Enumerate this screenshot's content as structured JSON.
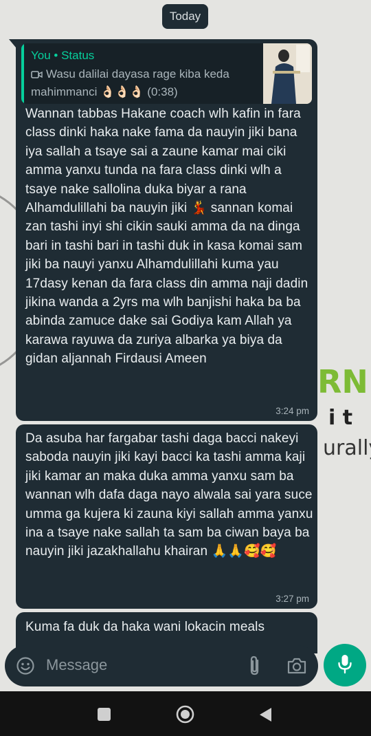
{
  "date_chip": "Today",
  "reply_quote": {
    "author": "You • Status",
    "text": "Wasu dalilai dayasa rage kiba keda mahimmanci 👌🏻👌🏻👌🏻 (0:38)",
    "icon": "video-icon"
  },
  "messages": [
    {
      "text": "Wannan tabbas Hakane coach wlh kafin in fara class dinki haka nake fama da nauyin jiki bana iya sallah a tsaye sai a zaune kamar mai ciki amma yanxu tunda na fara class dinki wlh a tsaye nake sallolina duka biyar a rana Alhamdulillahi ba nauyin jiki 💃 sannan komai zan tashi inyi shi cikin sauki amma da na dinga bari in tashi bari in tashi duk in kasa komai sam jiki ba nauyi yanxu Alhamdulillahi kuma yau 17dasy kenan da fara class din amma naji dadin jikina wanda a 2yrs ma wlh banjishi haka ba ba abinda zamuce dake sai Godiya kam Allah ya karawa rayuwa da zuriya albarka ya biya da gidan aljannah Firdausi Ameen",
      "time": "3:24 pm"
    },
    {
      "text": "Da asuba har fargabar tashi daga bacci nakeyi saboda nauyin jiki kayi bacci ka tashi amma kaji jiki kamar an maka duka amma yanxu sam ba wannan wlh dafa daga nayo alwala sai yara suce umma ga kujera ki zauna kiyi sallah amma yanxu ina a tsaye nake sallah ta sam ba ciwan baya ba nauyin jiki jazakhallahu khairan 🙏🙏🥰🥰",
      "time": "3:27 pm"
    },
    {
      "text": "Kuma fa duk da haka wani lokacin meals"
    }
  ],
  "input": {
    "placeholder": "Message"
  },
  "colors": {
    "bubble": "#1f2c34",
    "accent": "#06cf9c",
    "mic_button": "#00a884",
    "wallpaper": "#e4e4e1"
  },
  "icons": [
    "emoji-icon",
    "attach-icon",
    "camera-icon",
    "mic-icon",
    "nav-recents-icon",
    "nav-home-icon",
    "nav-back-icon"
  ]
}
